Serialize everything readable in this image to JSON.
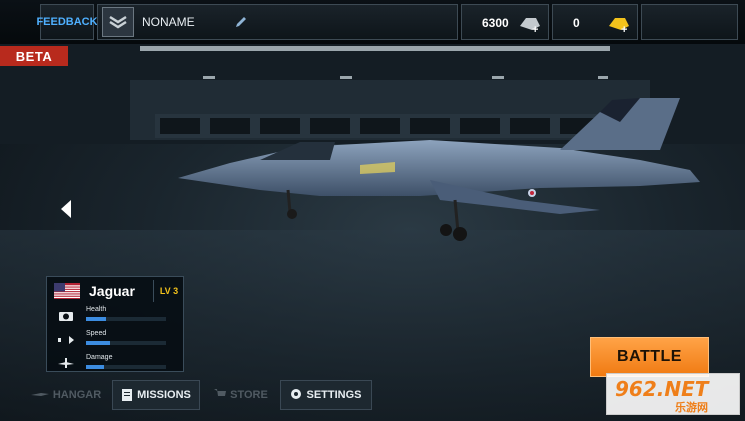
{
  "topbar": {
    "feedback_label": "FEEDBACK",
    "player_name": "NONAME",
    "rank_icon": "chevron-rank-icon",
    "edit_icon": "pencil-icon",
    "silver_amount": "6300",
    "silver_icon": "silver-add-icon",
    "gold_amount": "0",
    "gold_icon": "gold-add-icon"
  },
  "beta_label": "BETA",
  "aircraft": {
    "name": "Jaguar",
    "level": "LV 3",
    "flag_icon": "us-flag-icon",
    "stats": [
      {
        "label": "Health",
        "icon": "health-icon",
        "value": 0.25
      },
      {
        "label": "Speed",
        "icon": "speed-icon",
        "value": 0.3
      },
      {
        "label": "Damage",
        "icon": "damage-icon",
        "value": 0.22
      }
    ]
  },
  "nav": {
    "hangar_label": "HANGAR",
    "missions_label": "MISSIONS",
    "store_label": "STORE",
    "settings_label": "SETTINGS"
  },
  "battle_label": "BATTLE",
  "watermark": {
    "main": "962.NET",
    "sub": "乐游网"
  },
  "colors": {
    "accent": "#4fb0ff",
    "beta": "#b82a1d",
    "battle": "#f5841e",
    "stat_fill": "#3c8ce0"
  }
}
